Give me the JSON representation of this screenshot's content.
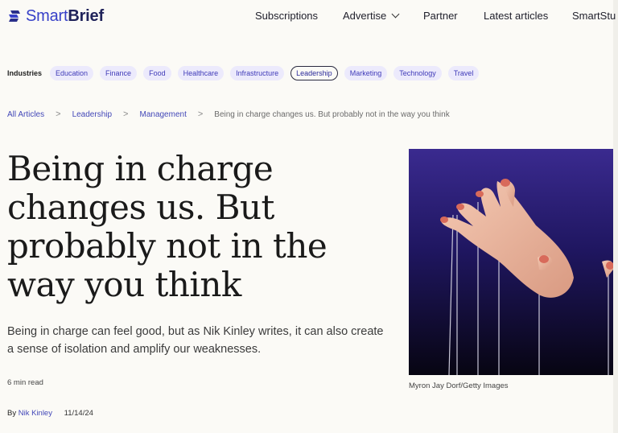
{
  "brand": {
    "name_light": "Smart",
    "name_bold": "Brief"
  },
  "nav": {
    "subscriptions": "Subscriptions",
    "advertise": "Advertise",
    "partner": "Partner",
    "latest": "Latest articles",
    "smartstudio": "SmartStu"
  },
  "industries": {
    "label": "Industries",
    "items": [
      "Education",
      "Finance",
      "Food",
      "Healthcare",
      "Infrastructure",
      "Leadership",
      "Marketing",
      "Technology",
      "Travel"
    ],
    "active": "Leadership"
  },
  "breadcrumb": {
    "all": "All Articles",
    "leadership": "Leadership",
    "management": "Management",
    "current": "Being in charge changes us. But probably not in the way you think",
    "separator": ">"
  },
  "article": {
    "headline": "Being in charge changes us. But probably not in the way you think",
    "dek": "Being in charge can feel good, but as Nik Kinley writes, it can also create a sense of isolation and amplify our weaknesses.",
    "read_time": "6 min read",
    "by": "By",
    "author": "Nik Kinley",
    "date": "11/14/24",
    "image_credit": "Myron Jay Dorf/Getty Images"
  },
  "colors": {
    "accent": "#3740c8",
    "pill_bg": "#eceafc",
    "background": "#fbfaf6"
  }
}
